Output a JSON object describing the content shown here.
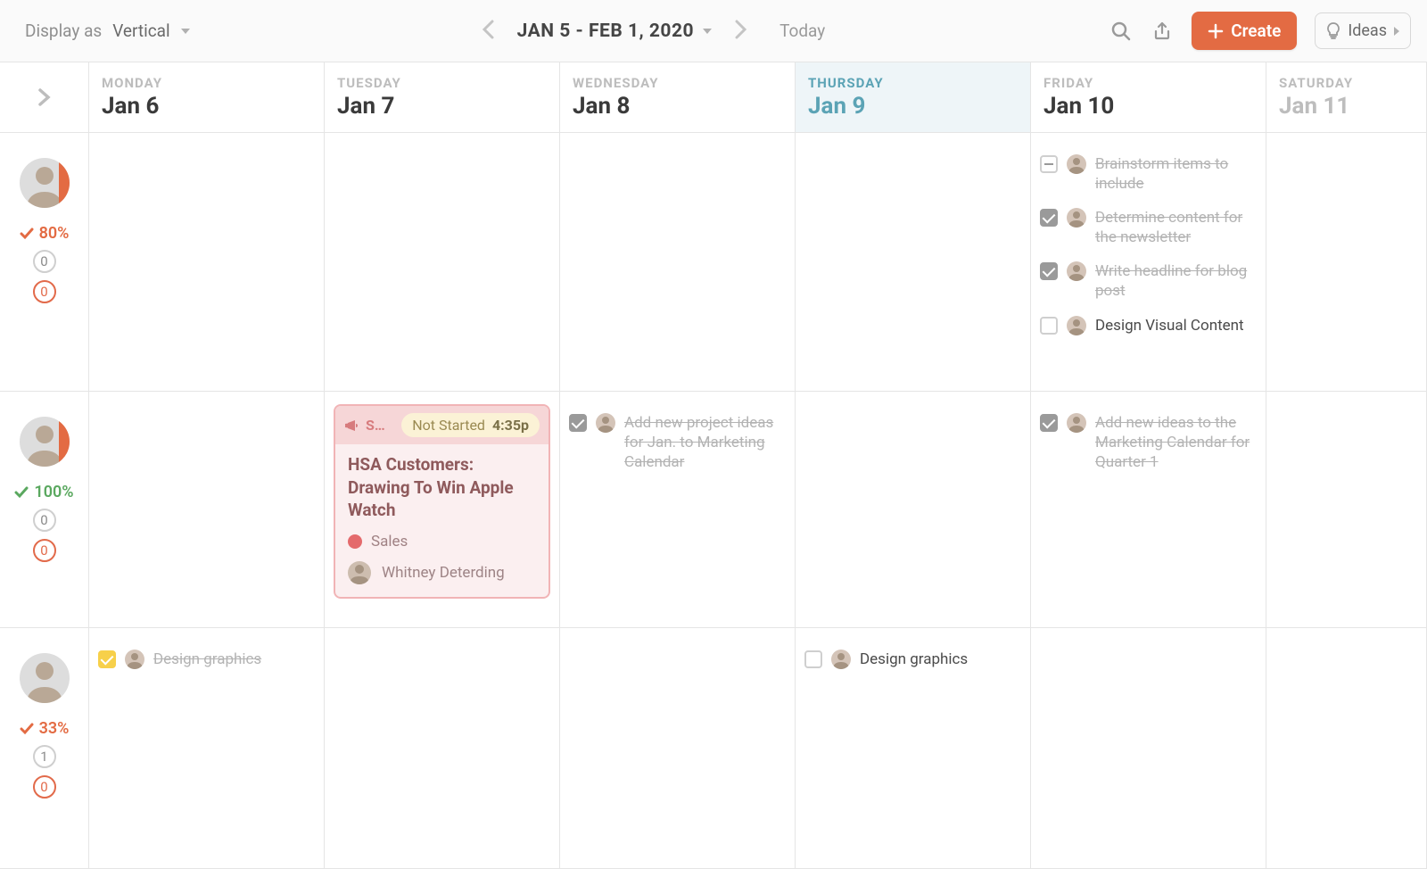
{
  "toolbar": {
    "display_as_label": "Display as",
    "display_value": "Vertical",
    "range_label": "JAN 5 - FEB 1, 2020",
    "today_label": "Today",
    "create_label": "Create",
    "ideas_label": "Ideas"
  },
  "columns": [
    {
      "dow": "MONDAY",
      "date": "Jan 6",
      "today": false
    },
    {
      "dow": "TUESDAY",
      "date": "Jan 7",
      "today": false
    },
    {
      "dow": "WEDNESDAY",
      "date": "Jan 8",
      "today": false
    },
    {
      "dow": "THURSDAY",
      "date": "Jan 9",
      "today": true
    },
    {
      "dow": "FRIDAY",
      "date": "Jan 10",
      "today": false
    },
    {
      "dow": "SATURDAY",
      "date": "Jan 11",
      "today": false
    }
  ],
  "rows": [
    {
      "percent": "80%",
      "percent_tone": "orange",
      "counter1": "0",
      "counter2": "0",
      "cells": {
        "fri": [
          {
            "state": "minus",
            "done": true,
            "text": "Brainstorm items to include"
          },
          {
            "state": "checked",
            "done": true,
            "text": "Determine content for the newsletter"
          },
          {
            "state": "checked",
            "done": true,
            "text": "Write headline for blog post"
          },
          {
            "state": "empty",
            "done": false,
            "text": "Design Visual Content"
          }
        ]
      }
    },
    {
      "percent": "100%",
      "percent_tone": "green",
      "counter1": "0",
      "counter2": "0",
      "card": {
        "type_abbrev": "S…",
        "status": "Not Started",
        "time": "4:35p",
        "title": "HSA Customers: Drawing To Win Apple Watch",
        "tag": "Sales",
        "assignee": "Whitney Deterding"
      },
      "cells": {
        "wed": [
          {
            "state": "checked",
            "done": true,
            "text": "Add new project ideas for Jan. to Marketing Calendar"
          }
        ],
        "fri": [
          {
            "state": "checked",
            "done": true,
            "text": "Add new ideas to the Marketing Calendar for Quarter 1"
          }
        ]
      }
    },
    {
      "percent": "33%",
      "percent_tone": "orange",
      "counter1": "1",
      "counter2": "0",
      "cells": {
        "mon": [
          {
            "state": "yellow",
            "done": true,
            "text": "Design graphics"
          }
        ],
        "thu": [
          {
            "state": "empty",
            "done": false,
            "text": "Design graphics"
          }
        ]
      }
    }
  ]
}
